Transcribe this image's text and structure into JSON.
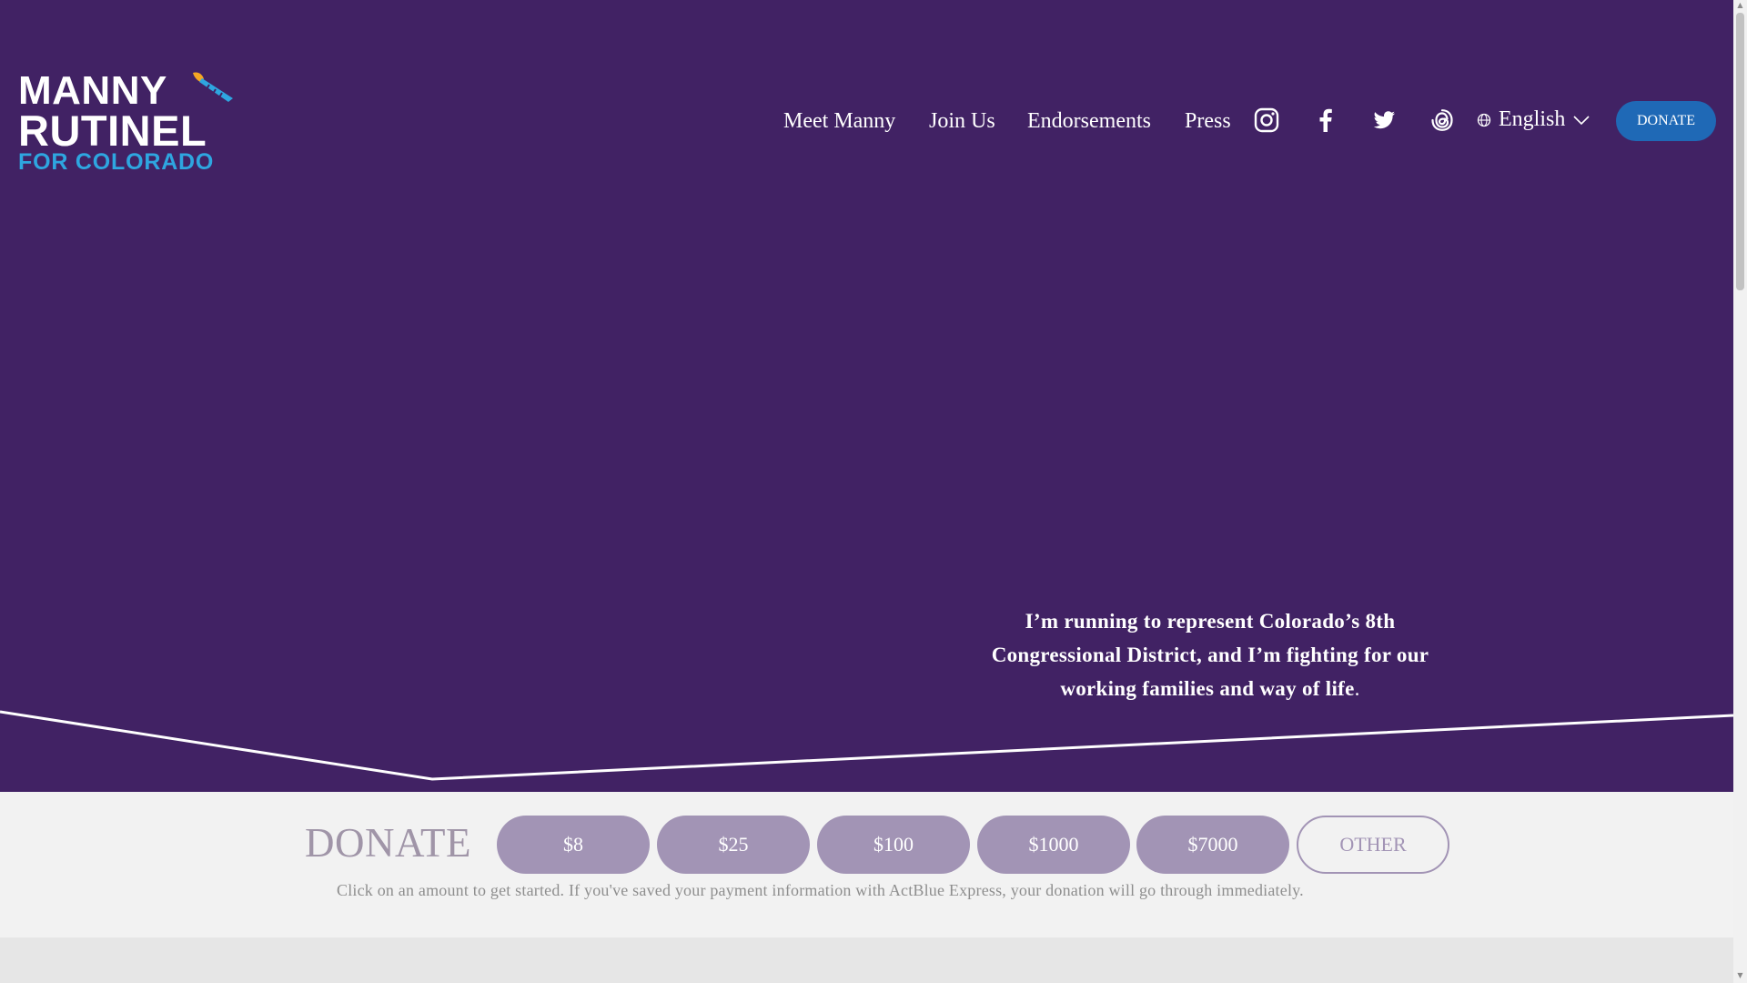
{
  "logo": {
    "line1": "MANNY",
    "line2": "RUTINEL",
    "line3": "FOR COLORADO"
  },
  "nav": {
    "links": [
      "Meet Manny",
      "Join Us",
      "Endorsements",
      "Press"
    ],
    "social_icons": [
      "instagram-icon",
      "facebook-icon",
      "twitter-icon",
      "threads-icon"
    ],
    "language": "English",
    "donate_label": "DONATE"
  },
  "hero": {
    "tagline": "I’m running to represent Colorado’s 8th Congressional District, and I’m fighting for our working families and way of life",
    "tagline_end": "."
  },
  "donate": {
    "title": "DONATE",
    "amounts": [
      "$8",
      "$25",
      "$100",
      "$1000",
      "$7000"
    ],
    "other_label": "OTHER",
    "note": "Click on an amount to get started. If you've saved your payment information with ActBlue Express, your donation will go through immediately."
  },
  "colors": {
    "hero_bg": "#412264",
    "page_bg": "#f2f2f2",
    "accent_blue": "#1f69b6",
    "logo_blue": "#2ea6e0",
    "button_purple": "#a294b5",
    "brush_orange": "#f5a623"
  }
}
